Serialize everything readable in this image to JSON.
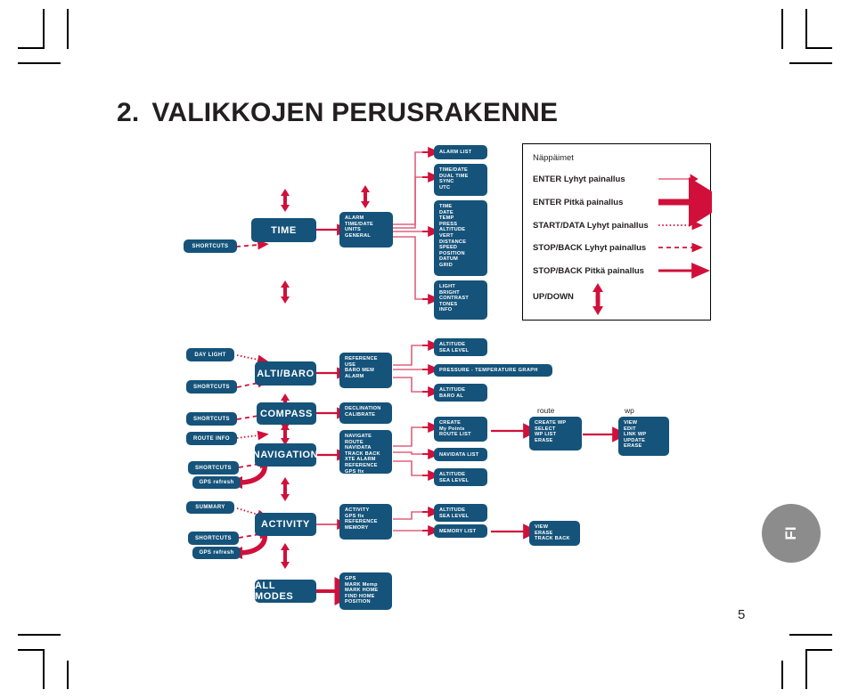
{
  "document": {
    "title_number": "2.",
    "title_text": "VALIKKOJEN PERUSRAKENNE",
    "page_number": "5",
    "language_badge": "FI"
  },
  "legend": {
    "heading": "Näppäimet",
    "rows": [
      {
        "label": "ENTER Lyhyt painallus",
        "style": "thin-solid-arrow"
      },
      {
        "label": "ENTER Pitkä painallus",
        "style": "thick-solid-arrow"
      },
      {
        "label": "START/DATA Lyhyt painallus",
        "style": "dotted-arrow"
      },
      {
        "label": "STOP/BACK Lyhyt painallus",
        "style": "dashed-arrow"
      },
      {
        "label": "STOP/BACK Pitkä painallus",
        "style": "medium-solid-arrow"
      },
      {
        "label": "UP/DOWN",
        "style": "up-down-arrows"
      }
    ]
  },
  "colors": {
    "box_blue": "#15537a",
    "arrow_red": "#d0103a",
    "arrow_pink": "#e8607f",
    "badge_gray": "#8c8c8c",
    "text_dark": "#231f20"
  },
  "labels": {
    "route": "route",
    "wp": "wp"
  },
  "nodes": {
    "time_mode": "TIME",
    "time_shortcuts": "SHORTCUTS",
    "time_sub": [
      "ALARM",
      "TIME/DATE",
      "UNITS",
      "GENERAL"
    ],
    "alarm_list": [
      "ALARM LIST"
    ],
    "time_date_list": [
      "TIME/DATE",
      "DUAL TIME",
      "SYNC",
      "UTC"
    ],
    "units_list": [
      "TIME",
      "DATE",
      "TEMP",
      "PRESS",
      "ALTITUDE",
      "VERT",
      "DISTANCE",
      "SPEED",
      "POSITION",
      "DATUM",
      "GRID"
    ],
    "general_list": [
      "LIGHT",
      "BRIGHT",
      "CONTRAST",
      "TONES",
      "INFO"
    ],
    "day_light": "DAY LIGHT",
    "altibaro_shortcuts": "SHORTCUTS",
    "altibaro_mode": "ALTI/BARO",
    "altibaro_sub": [
      "REFERENCE",
      "USE",
      "BARO MEM",
      "ALARM"
    ],
    "altitude_sea_level_1": [
      "ALTITUDE",
      "SEA LEVEL"
    ],
    "pressure_temp_graph": "PRESSURE - TEMPERATURE  GRAPH",
    "altitude_baro_al": [
      "ALTITUDE",
      "BARO AL"
    ],
    "compass_shortcuts": "SHORTCUTS",
    "compass_mode": "COMPASS",
    "compass_sub": [
      "DECLINATION",
      "CALIBRATE"
    ],
    "route_info": "ROUTE INFO",
    "navigation_shortcuts": "SHORTCUTS",
    "navigation_gps_refresh": "GPS refresh",
    "navigation_mode": "NAVIGATION",
    "navigation_sub": [
      "NAVIGATE",
      "ROUTE",
      "NAVIDATA",
      "TRACK BACK",
      "XTE ALARM",
      "REFERENCE",
      "GPS fix"
    ],
    "create_list": [
      "CREATE",
      "My Points",
      "ROUTE LIST"
    ],
    "navidata_list": [
      "NAVIDATA LIST"
    ],
    "altitude_sea_level_2": [
      "ALTITUDE",
      "SEA LEVEL"
    ],
    "route_box": [
      "CREATE WP",
      "SELECT",
      "WP LIST",
      "ERASE"
    ],
    "wp_box": [
      "VIEW",
      "EDIT",
      "LINK WP",
      "UPDATE",
      "ERASE"
    ],
    "summary": "SUMMARY",
    "activity_shortcuts": "SHORTCUTS",
    "activity_gps_refresh": "GPS refresh",
    "activity_mode": "ACTIVITY",
    "activity_sub": [
      "ACTIVITY",
      "GPS fix",
      "REFERENCE",
      "MEMORY"
    ],
    "altitude_sea_level_3": [
      "ALTITUDE",
      "SEA LEVEL"
    ],
    "memory_list": "MEMORY LIST",
    "memory_detail": [
      "VIEW",
      "ERASE",
      "TRACK BACK"
    ],
    "all_modes": "ALL MODES",
    "all_modes_sub": [
      "GPS",
      "MARK Memp",
      "MARK HOME",
      "FIND HOME",
      "POSITION"
    ]
  }
}
